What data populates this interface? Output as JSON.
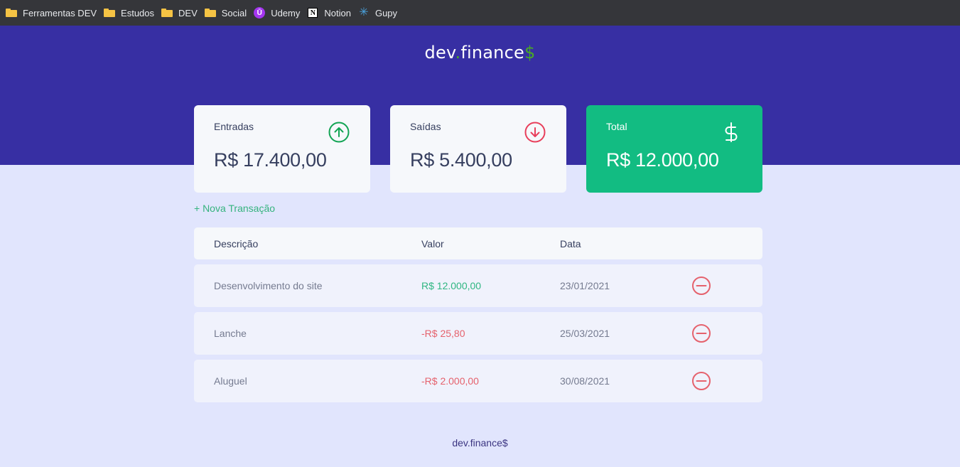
{
  "bookmarks": [
    {
      "label": "Ferramentas DEV",
      "icon": "folder-icon"
    },
    {
      "label": "Estudos",
      "icon": "folder-icon"
    },
    {
      "label": "DEV",
      "icon": "folder-icon"
    },
    {
      "label": "Social",
      "icon": "folder-icon"
    },
    {
      "label": "Udemy",
      "icon": "udemy-icon"
    },
    {
      "label": "Notion",
      "icon": "notion-icon"
    },
    {
      "label": "Gupy",
      "icon": "gupy-icon"
    }
  ],
  "header": {
    "logo_main": "dev",
    "logo_dot": ".",
    "logo_rest": "finance",
    "logo_dollar": "$"
  },
  "cards": {
    "income": {
      "label": "Entradas",
      "amount": "R$ 17.400,00",
      "icon": "arrow-up-circle-icon"
    },
    "expense": {
      "label": "Saídas",
      "amount": "R$ 5.400,00",
      "icon": "arrow-down-circle-icon"
    },
    "total": {
      "label": "Total",
      "amount": "R$ 12.000,00",
      "icon": "dollar-icon"
    }
  },
  "new_transaction_label": "+ Nova Transação",
  "table": {
    "headers": {
      "description": "Descrição",
      "value": "Valor",
      "date": "Data"
    },
    "rows": [
      {
        "description": "Desenvolvimento do site",
        "value": "R$ 12.000,00",
        "type": "income",
        "date": "23/01/2021"
      },
      {
        "description": "Lanche",
        "value": "-R$ 25,80",
        "type": "expense",
        "date": "25/03/2021"
      },
      {
        "description": "Aluguel",
        "value": "-R$ 2.000,00",
        "type": "expense",
        "date": "30/08/2021"
      }
    ]
  },
  "footer": "dev.finance$",
  "colors": {
    "header_bg": "#372fa3",
    "page_bg": "#e1e5fd",
    "total_card": "#12bc82",
    "income_green": "#12a454",
    "expense_red": "#e92929",
    "logo_accent": "#49aa26"
  }
}
